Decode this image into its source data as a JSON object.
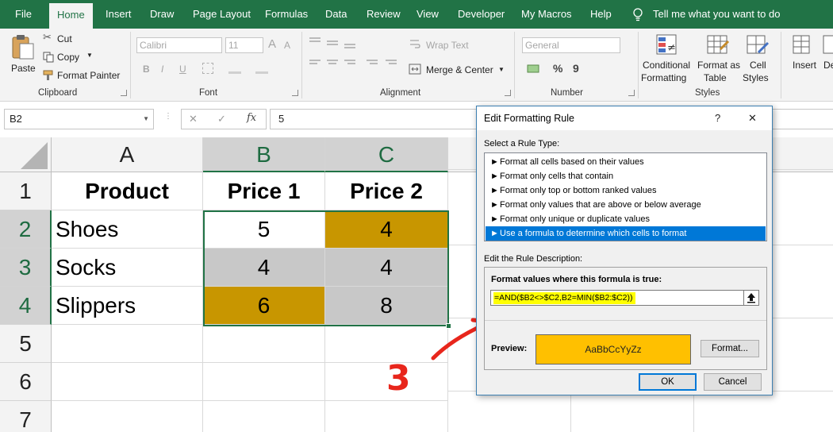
{
  "menu": {
    "tabs": [
      "File",
      "Home",
      "Insert",
      "Draw",
      "Page Layout",
      "Formulas",
      "Data",
      "Review",
      "View",
      "Developer",
      "My Macros",
      "Help"
    ],
    "active_tab": "Home",
    "tell_me": "Tell me what you want to do"
  },
  "ribbon": {
    "clipboard": {
      "paste": "Paste",
      "cut": "Cut",
      "copy": "Copy",
      "format_painter": "Format Painter",
      "label": "Clipboard"
    },
    "font": {
      "font_name": "Calibri",
      "font_size": "11",
      "bold": "B",
      "italic": "I",
      "underline": "U",
      "grow": "A",
      "shrink": "A",
      "label": "Font"
    },
    "alignment": {
      "wrap_text": "Wrap Text",
      "merge_center": "Merge & Center",
      "label": "Alignment"
    },
    "number": {
      "format": "General",
      "percent": "%",
      "comma": "9",
      "label": "Number"
    },
    "styles": {
      "conditional_1": "Conditional",
      "conditional_2": "Formatting",
      "format_table_1": "Format as",
      "format_table_2": "Table",
      "cell_styles_1": "Cell",
      "cell_styles_2": "Styles",
      "label": "Styles"
    },
    "cells": {
      "insert": "Insert",
      "delete": "De"
    }
  },
  "formula_bar": {
    "name_box": "B2",
    "cancel": "✕",
    "enter": "✓",
    "fx": "fx",
    "value": "5"
  },
  "sheet": {
    "columns": [
      "A",
      "B",
      "C"
    ],
    "rows": [
      "1",
      "2",
      "3",
      "4",
      "5",
      "6",
      "7"
    ],
    "cells": {
      "A1": "Product",
      "B1": "Price 1",
      "C1": "Price 2",
      "A2": "Shoes",
      "B2": "5",
      "C2": "4",
      "A3": "Socks",
      "B3": "4",
      "C3": "4",
      "A4": "Slippers",
      "B4": "6",
      "C4": "8"
    },
    "highlight_color": "#c89600",
    "grey_color": "#c8c8c8"
  },
  "annotation": {
    "number": "3",
    "color": "#e8261c"
  },
  "dialog": {
    "title": "Edit Formatting Rule",
    "help": "?",
    "close": "✕",
    "select_rule_type": "Select a Rule Type:",
    "rule_types": [
      "Format all cells based on their values",
      "Format only cells that contain",
      "Format only top or bottom ranked values",
      "Format only values that are above or below average",
      "Format only unique or duplicate values",
      "Use a formula to determine which cells to format"
    ],
    "selected_rule_index": 5,
    "edit_description": "Edit the Rule Description:",
    "formula_label": "Format values where this formula is true:",
    "formula": "=AND($B2<>$C2,B2=MIN($B2:$C2))",
    "preview_label": "Preview:",
    "preview_text": "AaBbCcYyZz",
    "preview_color": "#ffc000",
    "format_button": "Format...",
    "ok_button": "OK",
    "cancel_button": "Cancel"
  }
}
